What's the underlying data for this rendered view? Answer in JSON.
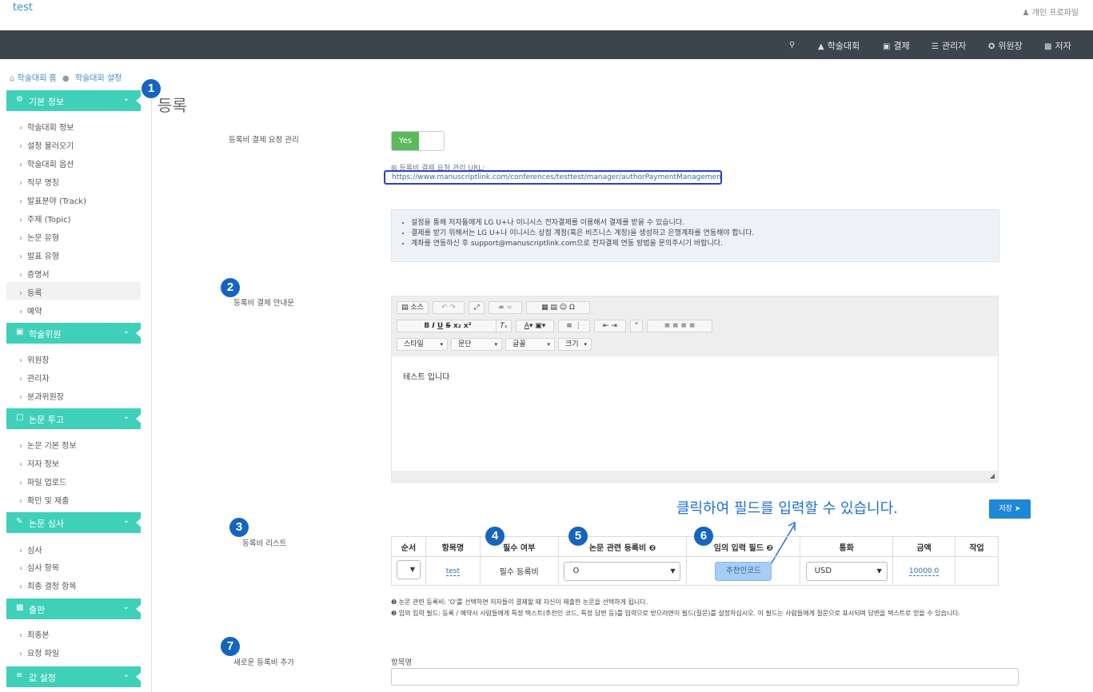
{
  "app": {
    "title": "test",
    "profile": "개인 프로파일"
  },
  "nav": [
    {
      "label": "",
      "icon": "search-icon"
    },
    {
      "label": "학술대회",
      "icon": "graduation-cap-icon"
    },
    {
      "label": "결제",
      "icon": "credit-card-icon"
    },
    {
      "label": "관리자",
      "icon": "server-icon"
    },
    {
      "label": "위원장",
      "icon": "gavel-icon"
    },
    {
      "label": "저자",
      "icon": "book-icon"
    }
  ],
  "breadcrumb": [
    "학술대회 홈",
    "학술대회 설정"
  ],
  "sidebar": {
    "sections": [
      {
        "title": "기본 정보",
        "icon": "gear-icon",
        "items": [
          "학술대회 정보",
          "설정 불러오기",
          "학술대회 옵션",
          "직무 명칭",
          "발표분야 (Track)",
          "주제 (Topic)",
          "논문 유형",
          "발표 유형",
          "증명서",
          "등록",
          "예약"
        ]
      },
      {
        "title": "학술위원",
        "icon": "briefcase-icon",
        "items": [
          "위원장",
          "관리자",
          "분과위원장"
        ]
      },
      {
        "title": "논문 투고",
        "icon": "file-icon",
        "items": [
          "논문 기본 정보",
          "저자 정보",
          "파일 업로드",
          "확인 및 제출"
        ]
      },
      {
        "title": "논문 심사",
        "icon": "edit-icon",
        "items": [
          "심사",
          "심사 항목",
          "최종 결정 항목"
        ]
      },
      {
        "title": "출판",
        "icon": "book-icon",
        "items": [
          "최종본",
          "요청 파일"
        ]
      },
      {
        "title": "값 설정",
        "icon": "sliders-icon",
        "items": []
      }
    ]
  },
  "main": {
    "title": "등록",
    "payment_manage": {
      "label": "등록비 결제 요청 관리",
      "toggle": "Yes",
      "url_label": "등록비 결제 요청 관리 URL:",
      "url": "https://www.manuscriptlink.com/conferences/testtest/manager/authorPaymentManagement"
    },
    "info": [
      "설정을 통해 저자들에게 LG U+나 이니시스 전자결제를 이용해서 결제를 받을 수 있습니다.",
      "결제를 받기 위해서는 LG U+나 이니시스 상점 계정(혹은 비즈니스 계정)을 생성하고 은행계좌를 연동해야 합니다.",
      "계좌를 연동하신 후 support@manuscriptlink.com으로 전자결제 연동 방법을 문의주시기 바랍니다."
    ],
    "guide": {
      "label": "등록비 결제 안내문",
      "toolbar": {
        "source": "소스",
        "style": "스타일",
        "paragraph": "문단",
        "font": "글꼴",
        "size": "크기"
      },
      "content": "테스트 입니다"
    },
    "callout": "클릭하여 필드를 입력할 수 있습니다.",
    "save": "저장",
    "fee_list": {
      "label": "등록비 리스트",
      "headers": [
        "순서",
        "항목명",
        "필수 여부",
        "논문 관련 등록비",
        "임의 입력 필드",
        "통화",
        "금액",
        "작업"
      ],
      "row": {
        "order": "",
        "name": "test",
        "required": "필수 등록비",
        "paper_fee": "O",
        "field": "추천인코드",
        "currency": "USD",
        "amount": "10000.0"
      }
    },
    "notes": [
      "논문 관련 등록비: 'O'를 선택하면 저자들이 결제할 때 자신이 제출한 논문을 선택하게 됩니다.",
      "임의 입력 필드: 등록 / 예약시 사람들에게 특정 텍스트(추천인 코드, 특정 답변 등)를 입력으로 받으려면이 필드(질문)를 설정하십시오. 이 필드는 사람들에게 질문으로 표시되며 답변을 텍스트로 얻을 수 있습니다."
    ],
    "new_fee": {
      "label": "새로운 등록비 추가",
      "name_label": "항목명"
    }
  },
  "badges": [
    "1",
    "2",
    "3",
    "4",
    "5",
    "6",
    "7"
  ],
  "colors": {
    "accent": "#3fd0b9",
    "navbar": "#3c444d",
    "badge": "#1565c0",
    "callout": "#1f6fd4"
  }
}
